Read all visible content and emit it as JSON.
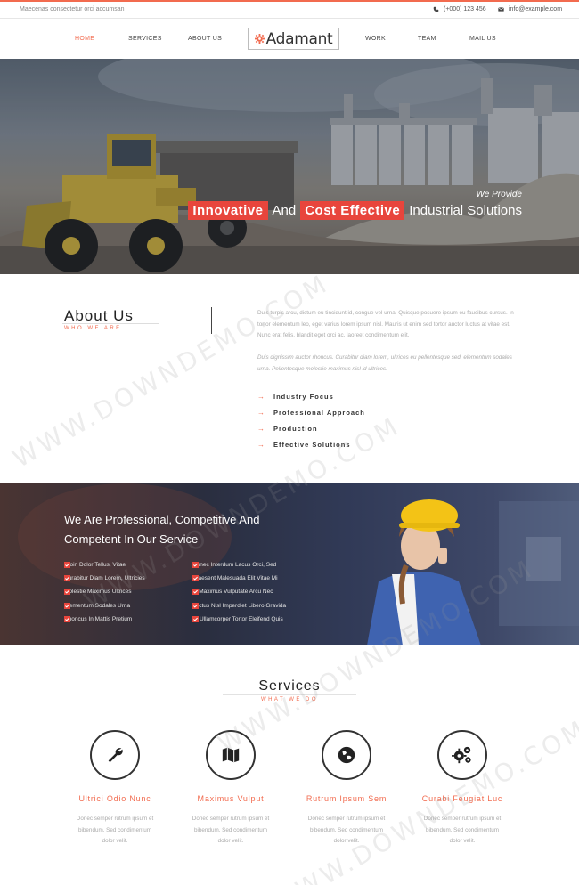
{
  "topbar": {
    "tagline": "Maecenas consectetur orci accumsan",
    "phone": "(+000) 123 456",
    "email": "info@example.com"
  },
  "nav": {
    "items": [
      "HOME",
      "SERVICES",
      "ABOUT US",
      "WORK",
      "TEAM",
      "MAIL US"
    ],
    "logo_text": "Adamant",
    "active": "HOME"
  },
  "hero": {
    "kicker": "We Provide",
    "highlight_1": "Innovative",
    "word_and": "And",
    "highlight_2": "Cost Effective",
    "tail": "Industrial Solutions"
  },
  "about": {
    "title": "About Us",
    "subtitle": "WHO WE ARE",
    "paragraph_1": "Duis turpis arcu, dictum eu tincidunt id, congue vel urna. Quisque posuere ipsum eu faucibus cursus. In tortor elementum leo, eget varius lorem ipsum nisl. Mauris ut enim sed tortor auctor luctus at vitae est. Nunc erat felis, blandit eget orci ac, laoreet condimentum elit.",
    "paragraph_2": "Duis dignissim auctor rhoncus. Curabitur diam lorem, ultrices eu pellentesque sed, elementum sodales urna. Pellentesque molestie maximus nisl id ultrices.",
    "features": [
      "Industry Focus",
      "Professional Approach",
      "Production",
      "Effective Solutions"
    ]
  },
  "professional": {
    "heading": "We Are Professional, Competitive And Competent In Our Service",
    "list_left": [
      "Proin Dolor Tellus, Vitae",
      "Curabitur Diam Lorem, Ultricies",
      "Molestie Maximus Ultrices",
      "Elementum Sodales Urna",
      "Rhoncus In Mattis Pretium"
    ],
    "list_right": [
      "Donec Interdum Lacus Orci, Sed",
      "Praesent Malesuada Elit Vitae Mi",
      "In Maximus Vulputate Arcu Nec",
      "Lectus Nisl Imperdiet Libero Gravida",
      "At Ullamcorper Tortor Eleifend Quis"
    ]
  },
  "services": {
    "title": "Services",
    "subtitle": "WHAT WE DO",
    "items": [
      {
        "name": "Ultrici Odio Nunc",
        "desc": "Donec semper rutrum ipsum et bibendum. Sed condimentum dolor velit.",
        "icon": "wrench-icon"
      },
      {
        "name": "Maximus Vulput",
        "desc": "Donec semper rutrum ipsum et bibendum. Sed condimentum dolor velit.",
        "icon": "map-icon"
      },
      {
        "name": "Rutrum Ipsum Sem",
        "desc": "Donec semper rutrum ipsum et bibendum. Sed condimentum dolor velit.",
        "icon": "globe-icon"
      },
      {
        "name": "Curabi Feugiat Luc",
        "desc": "Donec semper rutrum ipsum et bibendum. Sed condimentum dolor velit.",
        "icon": "gears-icon"
      }
    ]
  },
  "watermark": "WWW.DOWNDEMO.COM",
  "colors": {
    "accent": "#f26b4f",
    "highlight": "#e8453c",
    "text_dark": "#222222"
  }
}
